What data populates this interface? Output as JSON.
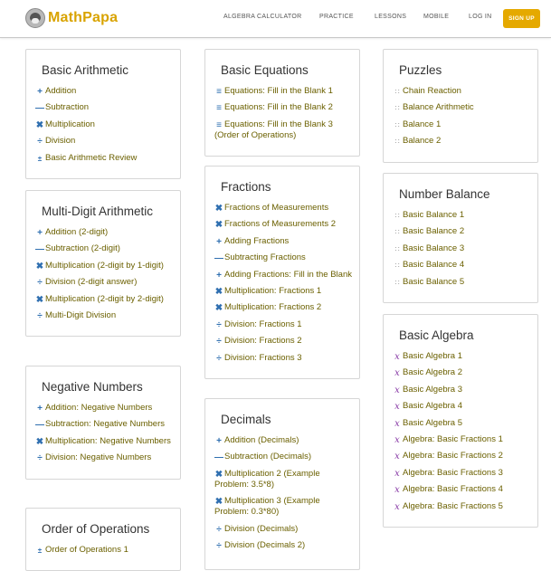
{
  "brand": {
    "name": "MathPapa"
  },
  "nav": {
    "algebra_calculator": "ALGEBRA CALCULATOR",
    "practice": "PRACTICE",
    "lessons": "LESSONS",
    "mobile": "MOBILE",
    "login": "LOG IN",
    "signup": "SIGN UP"
  },
  "cards": {
    "basic_arithmetic": {
      "title": "Basic Arithmetic",
      "items": [
        {
          "label": "Addition",
          "icon": "plus-icon"
        },
        {
          "label": "Subtraction",
          "icon": "minus-icon"
        },
        {
          "label": "Multiplication",
          "icon": "times-icon"
        },
        {
          "label": "Division",
          "icon": "divide-icon"
        },
        {
          "label": "Basic Arithmetic Review",
          "icon": "review-icon"
        }
      ]
    },
    "multi_digit": {
      "title": "Multi-Digit Arithmetic",
      "items": [
        {
          "label": "Addition (2-digit)",
          "icon": "plus-icon"
        },
        {
          "label": "Subtraction (2-digit)",
          "icon": "minus-icon"
        },
        {
          "label": "Multiplication (2-digit by 1-digit)",
          "icon": "times-icon"
        },
        {
          "label": "Division (2-digit answer)",
          "icon": "divide-icon"
        },
        {
          "label": "Multiplication (2-digit by 2-digit)",
          "icon": "times-icon"
        },
        {
          "label": "Multi-Digit Division",
          "icon": "divide-icon"
        }
      ]
    },
    "negative_numbers": {
      "title": "Negative Numbers",
      "items": [
        {
          "label": "Addition: Negative Numbers",
          "icon": "plus-icon"
        },
        {
          "label": "Subtraction: Negative Numbers",
          "icon": "minus-icon"
        },
        {
          "label": "Multiplication: Negative Numbers",
          "icon": "times-icon"
        },
        {
          "label": "Division: Negative Numbers",
          "icon": "divide-icon"
        }
      ]
    },
    "order_of_operations": {
      "title": "Order of Operations",
      "items": [
        {
          "label": "Order of Operations 1",
          "icon": "review-icon"
        }
      ]
    },
    "basic_equations": {
      "title": "Basic Equations",
      "items": [
        {
          "label": "Equations: Fill in the Blank 1",
          "icon": "equals-icon"
        },
        {
          "label": "Equations: Fill in the Blank 2",
          "icon": "equals-icon"
        },
        {
          "label": "Equations: Fill in the Blank 3 (Order of Operations)",
          "icon": "equals-icon"
        }
      ]
    },
    "fractions": {
      "title": "Fractions",
      "items": [
        {
          "label": "Fractions of Measurements",
          "icon": "times-icon"
        },
        {
          "label": "Fractions of Measurements 2",
          "icon": "times-icon"
        },
        {
          "label": "Adding Fractions",
          "icon": "plus-icon"
        },
        {
          "label": "Subtracting Fractions",
          "icon": "minus-icon"
        },
        {
          "label": "Adding Fractions: Fill in the Blank",
          "icon": "plus-icon"
        },
        {
          "label": "Multiplication: Fractions 1",
          "icon": "times-icon"
        },
        {
          "label": "Multiplication: Fractions 2",
          "icon": "times-icon"
        },
        {
          "label": "Division: Fractions 1",
          "icon": "divide-icon"
        },
        {
          "label": "Division: Fractions 2",
          "icon": "divide-icon"
        },
        {
          "label": "Division: Fractions 3",
          "icon": "divide-icon"
        }
      ]
    },
    "decimals": {
      "title": "Decimals",
      "items": [
        {
          "label": "Addition (Decimals)",
          "icon": "plus-icon"
        },
        {
          "label": "Subtraction (Decimals)",
          "icon": "minus-icon"
        },
        {
          "label": "Multiplication 2 (Example Problem: 3.5*8)",
          "icon": "times-icon"
        },
        {
          "label": "Multiplication 3 (Example Problem: 0.3*80)",
          "icon": "times-icon"
        },
        {
          "label": "Division (Decimals)",
          "icon": "divide-icon"
        },
        {
          "label": "Division (Decimals 2)",
          "icon": "divide-icon"
        }
      ]
    },
    "puzzles": {
      "title": "Puzzles",
      "items": [
        {
          "label": "Chain Reaction",
          "icon": "puzzle-icon"
        },
        {
          "label": "Balance Arithmetic",
          "icon": "puzzle-icon"
        },
        {
          "label": "Balance 1",
          "icon": "puzzle-icon"
        },
        {
          "label": "Balance 2",
          "icon": "puzzle-icon"
        }
      ]
    },
    "number_balance": {
      "title": "Number Balance",
      "items": [
        {
          "label": "Basic Balance 1",
          "icon": "puzzle-icon"
        },
        {
          "label": "Basic Balance 2",
          "icon": "puzzle-icon"
        },
        {
          "label": "Basic Balance 3",
          "icon": "puzzle-icon"
        },
        {
          "label": "Basic Balance 4",
          "icon": "puzzle-icon"
        },
        {
          "label": "Basic Balance 5",
          "icon": "puzzle-icon"
        }
      ]
    },
    "basic_algebra": {
      "title": "Basic Algebra",
      "items": [
        {
          "label": "Basic Algebra 1",
          "icon": "variable-x-icon"
        },
        {
          "label": "Basic Algebra 2",
          "icon": "variable-x-icon"
        },
        {
          "label": "Basic Algebra 3",
          "icon": "variable-x-icon"
        },
        {
          "label": "Basic Algebra 4",
          "icon": "variable-x-icon"
        },
        {
          "label": "Basic Algebra 5",
          "icon": "variable-x-icon"
        },
        {
          "label": "Algebra: Basic Fractions 1",
          "icon": "variable-x-icon"
        },
        {
          "label": "Algebra: Basic Fractions 2",
          "icon": "variable-x-icon"
        },
        {
          "label": "Algebra: Basic Fractions 3",
          "icon": "variable-x-icon"
        },
        {
          "label": "Algebra: Basic Fractions 4",
          "icon": "variable-x-icon"
        },
        {
          "label": "Algebra: Basic Fractions 5",
          "icon": "variable-x-icon"
        }
      ]
    }
  },
  "colors": {
    "brand": "#d9a300",
    "signup_bg": "#e5a900",
    "link": "#6b6000",
    "op_icon": "#2f6fb0",
    "algebra_icon": "#8b3fa8"
  }
}
